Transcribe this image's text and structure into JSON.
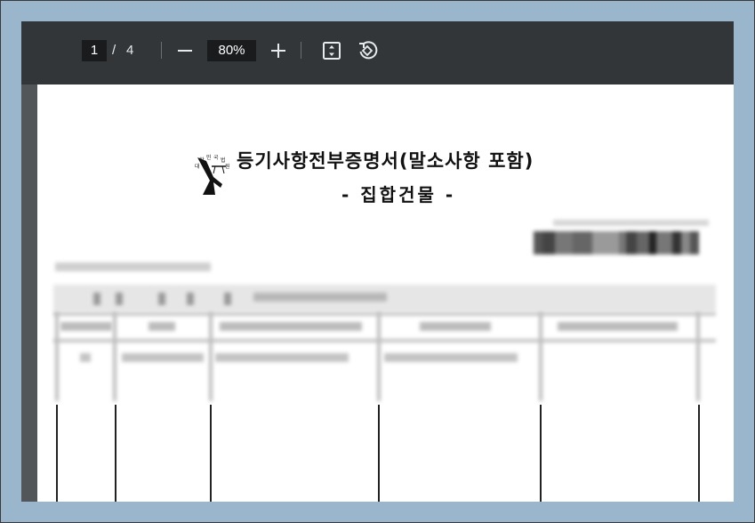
{
  "toolbar": {
    "current_page": "1",
    "page_separator": "/",
    "total_pages": "4",
    "zoom_out_icon": "minus-icon",
    "zoom_level": "80%",
    "zoom_in_icon": "plus-icon",
    "fit_icon": "fit-to-page-icon",
    "rotate_icon": "rotate-icon"
  },
  "document": {
    "title": "등기사항전부증명서(말소사항 포함)",
    "subtitle": "- 집합건물 -",
    "seal_icon": "court-seal-logo"
  },
  "colors": {
    "toolbar_bg": "#323639",
    "viewer_bg": "#525659",
    "desktop_bg": "#9ab6cc",
    "page_bg": "#ffffff"
  }
}
